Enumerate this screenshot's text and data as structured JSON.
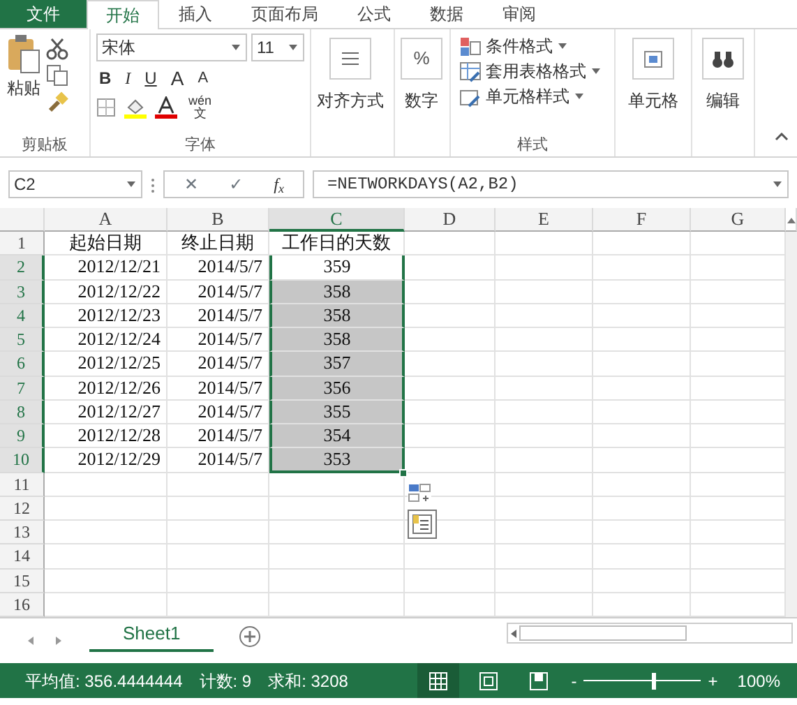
{
  "ribbon_tabs": [
    {
      "label": "文件",
      "kind": "file",
      "selected": false
    },
    {
      "label": "开始",
      "kind": "tab",
      "selected": true
    },
    {
      "label": "插入",
      "kind": "tab",
      "selected": false
    },
    {
      "label": "页面布局",
      "kind": "tab",
      "selected": false
    },
    {
      "label": "公式",
      "kind": "tab",
      "selected": false
    },
    {
      "label": "数据",
      "kind": "tab",
      "selected": false
    },
    {
      "label": "审阅",
      "kind": "tab",
      "selected": false
    }
  ],
  "ribbon": {
    "clipboard": {
      "paste": "粘贴",
      "label": "剪贴板"
    },
    "font": {
      "name": "宋体",
      "size": "11",
      "bold": "B",
      "italic": "I",
      "underline": "U",
      "grow": "A",
      "shrink": "A",
      "phonetic": "wén",
      "phonetic_char": "文",
      "label": "字体"
    },
    "alignment": {
      "label": "对齐方式"
    },
    "number": {
      "symbol": "%",
      "label": "数字"
    },
    "styles": {
      "items": [
        "条件格式",
        "套用表格格式",
        "单元格样式"
      ],
      "label": "样式"
    },
    "cells": {
      "label": "单元格"
    },
    "editing": {
      "label": "编辑"
    }
  },
  "formula_bar": {
    "name_box": "C2",
    "cancel": "✕",
    "enter": "✓",
    "function": "f$_{x}$",
    "formula": "=NETWORKDAYS(A2,B2)"
  },
  "sheet": {
    "columns": [
      {
        "label": "A",
        "selected": false
      },
      {
        "label": "B",
        "selected": false
      },
      {
        "label": "C",
        "selected": true
      },
      {
        "label": "D",
        "selected": false
      },
      {
        "label": "E",
        "selected": false
      },
      {
        "label": "F",
        "selected": false
      },
      {
        "label": "G",
        "selected": false
      }
    ],
    "rows": [
      {
        "number": "1",
        "selected": false,
        "active": false,
        "cells": [
          "起始日期",
          "终止日期",
          "工作日的天数"
        ]
      },
      {
        "number": "2",
        "selected": true,
        "active": true,
        "cells": [
          "2012/12/21",
          "2014/5/7",
          "359"
        ]
      },
      {
        "number": "3",
        "selected": true,
        "active": false,
        "cells": [
          "2012/12/22",
          "2014/5/7",
          "358"
        ]
      },
      {
        "number": "4",
        "selected": true,
        "active": false,
        "cells": [
          "2012/12/23",
          "2014/5/7",
          "358"
        ]
      },
      {
        "number": "5",
        "selected": true,
        "active": false,
        "cells": [
          "2012/12/24",
          "2014/5/7",
          "358"
        ]
      },
      {
        "number": "6",
        "selected": true,
        "active": false,
        "cells": [
          "2012/12/25",
          "2014/5/7",
          "357"
        ]
      },
      {
        "number": "7",
        "selected": true,
        "active": false,
        "cells": [
          "2012/12/26",
          "2014/5/7",
          "356"
        ]
      },
      {
        "number": "8",
        "selected": true,
        "active": false,
        "cells": [
          "2012/12/27",
          "2014/5/7",
          "355"
        ]
      },
      {
        "number": "9",
        "selected": true,
        "active": false,
        "cells": [
          "2012/12/28",
          "2014/5/7",
          "354"
        ]
      },
      {
        "number": "10",
        "selected": true,
        "active": false,
        "cells": [
          "2012/12/29",
          "2014/5/7",
          "353"
        ]
      },
      {
        "number": "11",
        "selected": false,
        "active": false,
        "cells": []
      },
      {
        "number": "12",
        "selected": false,
        "active": false,
        "cells": []
      },
      {
        "number": "13",
        "selected": false,
        "active": false,
        "cells": []
      },
      {
        "number": "14",
        "selected": false,
        "active": false,
        "cells": []
      },
      {
        "number": "15",
        "selected": false,
        "active": false,
        "cells": []
      },
      {
        "number": "16",
        "selected": false,
        "active": false,
        "cells": []
      }
    ]
  },
  "sheet_tabs": [
    {
      "label": "Sheet1",
      "selected": true
    }
  ],
  "status_bar": {
    "average": "平均值: 356.4444444",
    "count": "计数: 9",
    "sum": "求和: 3208",
    "views": [
      {
        "kind": "normal",
        "selected": true
      },
      {
        "kind": "layout",
        "selected": false
      },
      {
        "kind": "break",
        "selected": false
      }
    ],
    "zoom_out": "-",
    "zoom_in": "+",
    "zoom": {
      "level": 0.6
    },
    "zoom_text": "100%"
  }
}
